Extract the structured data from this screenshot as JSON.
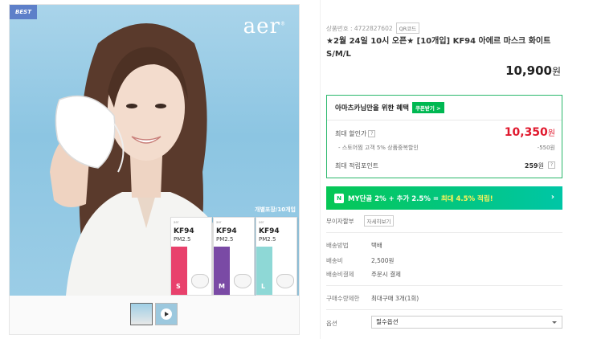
{
  "gallery": {
    "badge": "BEST",
    "brand_logo": "aer",
    "pack_tag": "개별포장/10개입",
    "packs": [
      {
        "brand": "aer",
        "kf": "KF94",
        "pm": "PM2.5",
        "size": "S",
        "color": "#e8416c"
      },
      {
        "brand": "aer",
        "kf": "KF94",
        "pm": "PM2.5",
        "size": "M",
        "color": "#7a4aa5"
      },
      {
        "brand": "aer",
        "kf": "KF94",
        "pm": "PM2.5",
        "size": "L",
        "color": "#8ed8d6"
      }
    ]
  },
  "product": {
    "id_label": "상품번호 : 4722827602",
    "qr_label": "QR코드",
    "title": "★2월 24일 10시 오픈★ [10개입] KF94 아에르 마스크 화이트 S/M/L",
    "price": "10,900",
    "currency": "원"
  },
  "benefit": {
    "heading": "아마츠카님만을 위한 혜택",
    "coupon_button": "쿠폰받기 >",
    "max_discount_label": "최대 할인가",
    "help": "?",
    "max_discount_price": "10,350",
    "currency": "원",
    "sub_label": "- 스토어찜 고객 5% 상품중복할인",
    "sub_value": "-550원",
    "points_label": "최대 적립포인트",
    "points_value": "259",
    "points_unit": "원"
  },
  "my_banner": {
    "n_badge": "N",
    "text_prefix": "MY단골 2% + 추가 2.5% =",
    "text_highlight": "최대 4.5% 적립!",
    "arrow": "›"
  },
  "interest": {
    "label": "무이자할부",
    "button": "자세히보기"
  },
  "shipping": {
    "method_label": "배송방법",
    "method_value": "택배",
    "fee_label": "배송비",
    "fee_value": "2,500원",
    "pay_label": "배송비결제",
    "pay_value": "주문시 결제"
  },
  "limit": {
    "label": "구매수량제한",
    "value": "최대구매 3개(1회)"
  },
  "option": {
    "label": "옵션",
    "selected": "필수옵션"
  }
}
